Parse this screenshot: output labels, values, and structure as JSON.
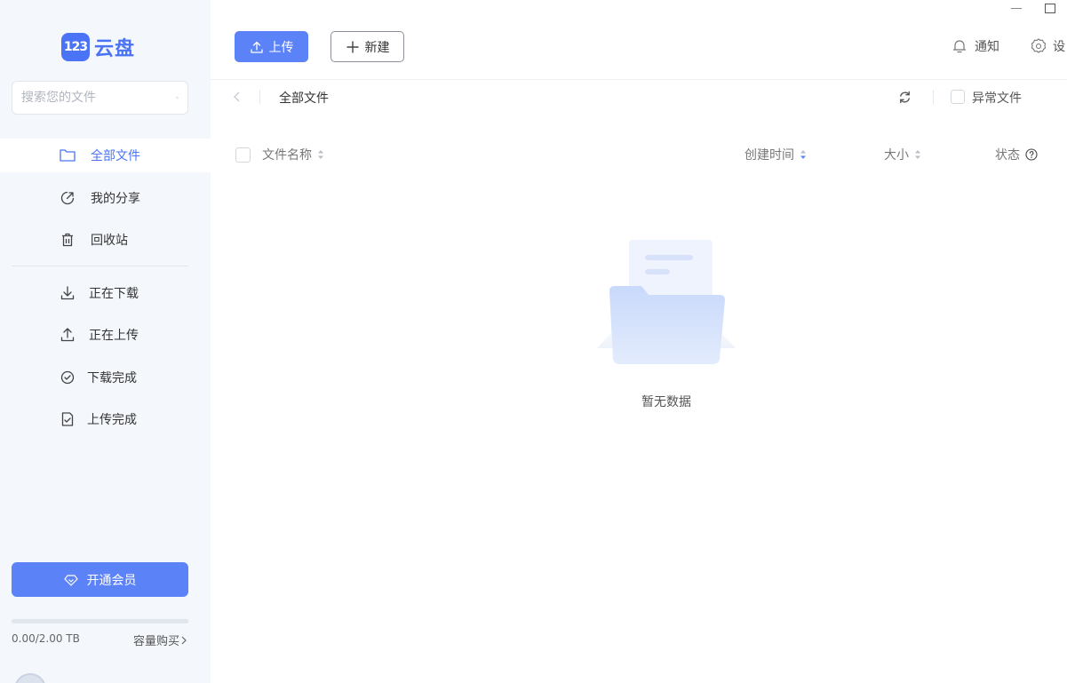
{
  "app": {
    "logo_badge": "123",
    "logo_text": "云盘"
  },
  "sidebar": {
    "search_placeholder": "搜索您的文件",
    "nav_top": [
      {
        "label": "全部文件",
        "icon": "folder-icon",
        "active": true
      },
      {
        "label": "我的分享",
        "icon": "share-icon",
        "active": false
      },
      {
        "label": "回收站",
        "icon": "trash-icon",
        "active": false
      }
    ],
    "nav_transfer": [
      {
        "label": "正在下载",
        "icon": "download-icon"
      },
      {
        "label": "正在上传",
        "icon": "upload-icon"
      },
      {
        "label": "下载完成",
        "icon": "check-circle-icon"
      },
      {
        "label": "上传完成",
        "icon": "file-check-icon"
      }
    ],
    "vip_label": "开通会员",
    "storage_used_fraction": 0,
    "storage_text": "0.00/2.00 TB",
    "storage_buy": "容量购买"
  },
  "toolbar": {
    "upload_label": "上传",
    "new_label": "新建",
    "notify_label": "通知",
    "settings_label": "设"
  },
  "breadcrumb": {
    "current": "全部文件",
    "abnormal_label": "异常文件"
  },
  "table": {
    "col_name": "文件名称",
    "col_created": "创建时间",
    "col_size": "大小",
    "col_status": "状态"
  },
  "empty": {
    "text": "暂无数据"
  },
  "colors": {
    "accent": "#5b82f7",
    "brand": "#4a73f5",
    "sidebar_bg": "#f4f7fc"
  }
}
